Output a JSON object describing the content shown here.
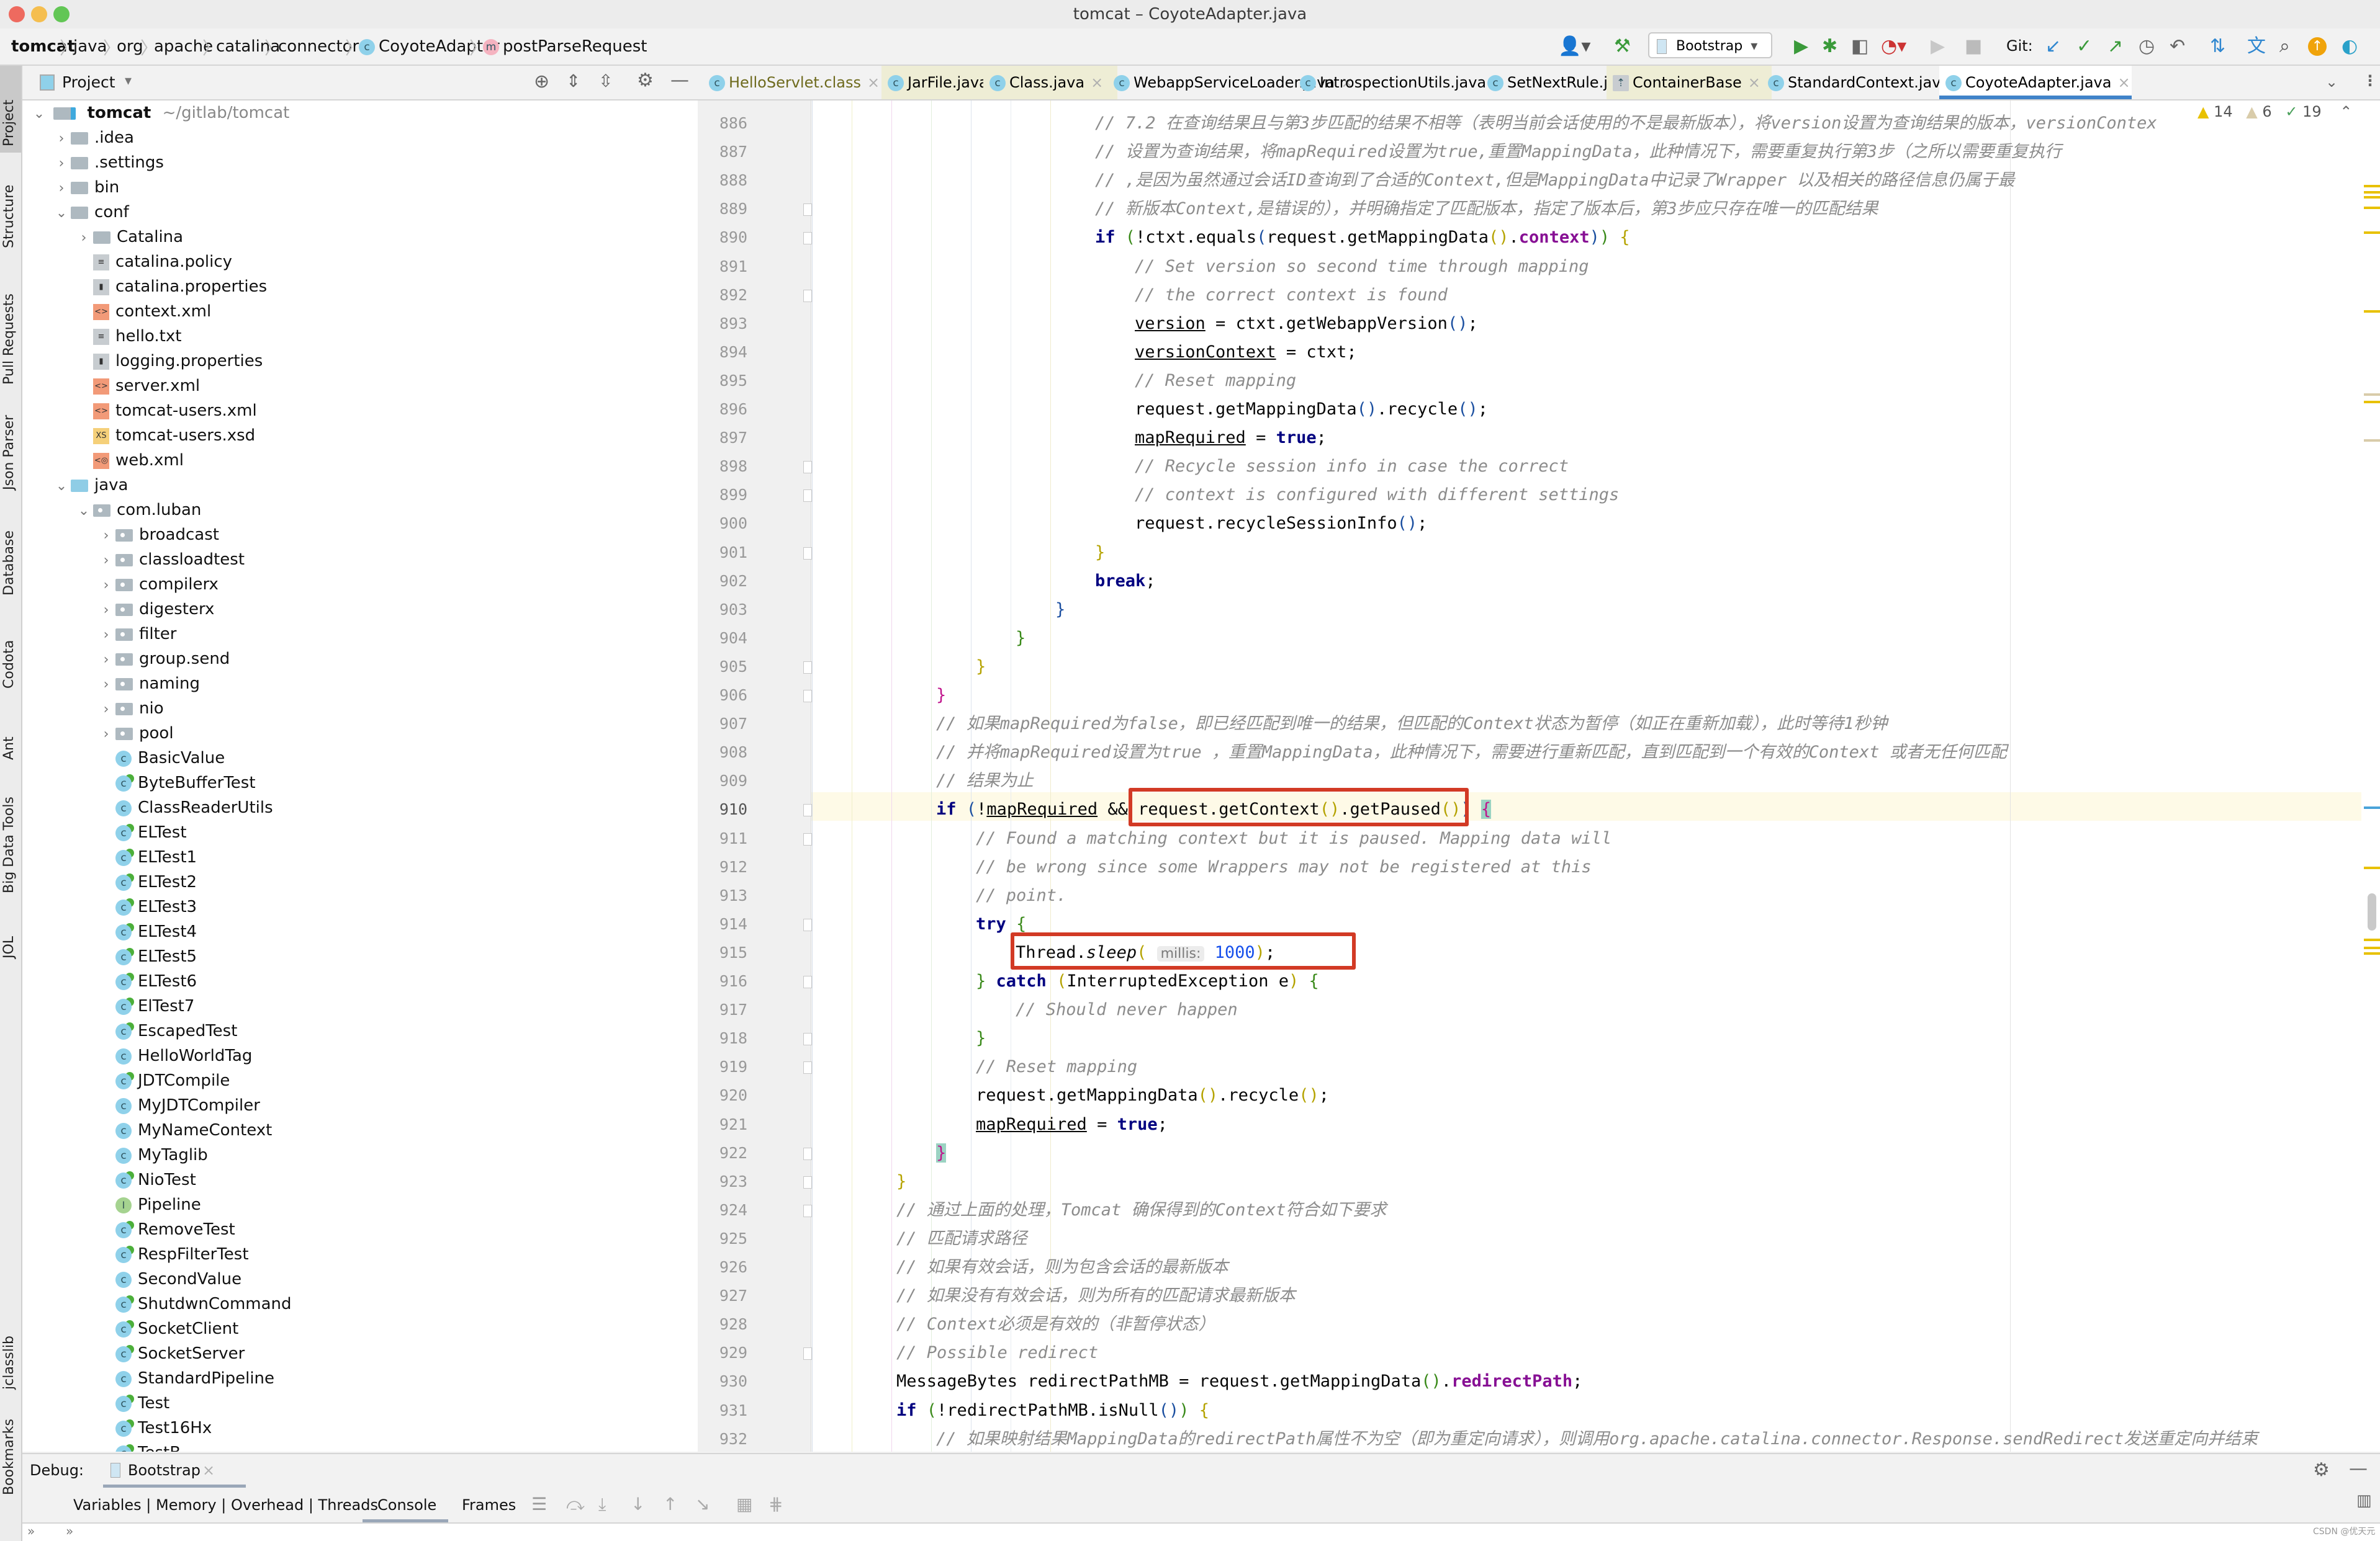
{
  "window": {
    "title": "tomcat – CoyoteAdapter.java",
    "traffic_lights": [
      "#ee6a5f",
      "#f5be4f",
      "#62c655"
    ]
  },
  "breadcrumb": [
    {
      "label": "tomcat",
      "bold": true
    },
    {
      "label": "java"
    },
    {
      "label": "org"
    },
    {
      "label": "apache"
    },
    {
      "label": "catalina"
    },
    {
      "label": "connector"
    },
    {
      "label": "CoyoteAdapter",
      "badge": "c"
    },
    {
      "label": "postParseRequest",
      "badge": "m"
    }
  ],
  "toolbar": {
    "run_config": "Bootstrap",
    "git_label": "Git:"
  },
  "left_strip": [
    "Project",
    "Structure",
    "Pull Requests",
    "Json Parser",
    "Database",
    "Codota",
    "Ant",
    "Big Data Tools",
    "JOL",
    "jclasslib",
    "Bookmarks"
  ],
  "project_panel": {
    "title": "Project",
    "root": {
      "name": "tomcat",
      "path": "~/gitlab/tomcat"
    },
    "items": [
      {
        "label": ".idea",
        "type": "folder",
        "depth": 1,
        "chev": ">"
      },
      {
        "label": ".settings",
        "type": "folder",
        "depth": 1,
        "chev": ">"
      },
      {
        "label": "bin",
        "type": "folder",
        "depth": 1,
        "chev": ">"
      },
      {
        "label": "conf",
        "type": "folder",
        "depth": 1,
        "chev": "v"
      },
      {
        "label": "Catalina",
        "type": "folder",
        "depth": 2,
        "chev": ">"
      },
      {
        "label": "catalina.policy",
        "type": "text",
        "depth": 2
      },
      {
        "label": "catalina.properties",
        "type": "props",
        "depth": 2
      },
      {
        "label": "context.xml",
        "type": "xml",
        "depth": 2
      },
      {
        "label": "hello.txt",
        "type": "text",
        "depth": 2
      },
      {
        "label": "logging.properties",
        "type": "props",
        "depth": 2
      },
      {
        "label": "server.xml",
        "type": "xml",
        "depth": 2
      },
      {
        "label": "tomcat-users.xml",
        "type": "xml",
        "depth": 2
      },
      {
        "label": "tomcat-users.xsd",
        "type": "xsd",
        "depth": 2
      },
      {
        "label": "web.xml",
        "type": "webxml",
        "depth": 2
      },
      {
        "label": "java",
        "type": "src",
        "depth": 1,
        "chev": "v"
      },
      {
        "label": "com.luban",
        "type": "pkg",
        "depth": 2,
        "chev": "v"
      },
      {
        "label": "broadcast",
        "type": "pkg",
        "depth": 3,
        "chev": ">"
      },
      {
        "label": "classloadtest",
        "type": "pkg",
        "depth": 3,
        "chev": ">"
      },
      {
        "label": "compilerx",
        "type": "pkg",
        "depth": 3,
        "chev": ">"
      },
      {
        "label": "digesterx",
        "type": "pkg",
        "depth": 3,
        "chev": ">"
      },
      {
        "label": "filter",
        "type": "pkg",
        "depth": 3,
        "chev": ">"
      },
      {
        "label": "group.send",
        "type": "pkg",
        "depth": 3,
        "chev": ">"
      },
      {
        "label": "naming",
        "type": "pkg",
        "depth": 3,
        "chev": ">"
      },
      {
        "label": "nio",
        "type": "pkg",
        "depth": 3,
        "chev": ">"
      },
      {
        "label": "pool",
        "type": "pkg",
        "depth": 3,
        "chev": ">"
      },
      {
        "label": "BasicValue",
        "type": "class",
        "depth": 3
      },
      {
        "label": "ByteBufferTest",
        "type": "class-run",
        "depth": 3
      },
      {
        "label": "ClassReaderUtils",
        "type": "class",
        "depth": 3
      },
      {
        "label": "ELTest",
        "type": "class-run",
        "depth": 3
      },
      {
        "label": "ELTest1",
        "type": "class-run",
        "depth": 3
      },
      {
        "label": "ELTest2",
        "type": "class-run",
        "depth": 3
      },
      {
        "label": "ELTest3",
        "type": "class-run",
        "depth": 3
      },
      {
        "label": "ELTest4",
        "type": "class-run",
        "depth": 3
      },
      {
        "label": "ELTest5",
        "type": "class-run",
        "depth": 3
      },
      {
        "label": "ELTest6",
        "type": "class-run",
        "depth": 3
      },
      {
        "label": "ElTest7",
        "type": "class-run",
        "depth": 3
      },
      {
        "label": "EscapedTest",
        "type": "class-run",
        "depth": 3
      },
      {
        "label": "HelloWorldTag",
        "type": "class",
        "depth": 3
      },
      {
        "label": "JDTCompile",
        "type": "class-run",
        "depth": 3
      },
      {
        "label": "MyJDTCompiler",
        "type": "class",
        "depth": 3
      },
      {
        "label": "MyNameContext",
        "type": "class",
        "depth": 3
      },
      {
        "label": "MyTaglib",
        "type": "class",
        "depth": 3
      },
      {
        "label": "NioTest",
        "type": "class-run",
        "depth": 3
      },
      {
        "label": "Pipeline",
        "type": "interface",
        "depth": 3
      },
      {
        "label": "RemoveTest",
        "type": "class-run",
        "depth": 3
      },
      {
        "label": "RespFilterTest",
        "type": "class-run",
        "depth": 3
      },
      {
        "label": "SecondValue",
        "type": "class",
        "depth": 3
      },
      {
        "label": "ShutdwnCommand",
        "type": "class-run",
        "depth": 3
      },
      {
        "label": "SocketClient",
        "type": "class-run",
        "depth": 3
      },
      {
        "label": "SocketServer",
        "type": "class-run",
        "depth": 3
      },
      {
        "label": "StandardPipeline",
        "type": "class",
        "depth": 3
      },
      {
        "label": "Test",
        "type": "class-run",
        "depth": 3
      },
      {
        "label": "Test16Hx",
        "type": "class-run",
        "depth": 3
      },
      {
        "label": "TestB",
        "type": "class-run",
        "depth": 3
      }
    ]
  },
  "editor_tabs": [
    {
      "label": "HelloServlet.class",
      "color": "#6e6a1d"
    },
    {
      "label": "JarFile.java",
      "highlight": true
    },
    {
      "label": "Class.java",
      "highlight": true
    },
    {
      "label": "WebappServiceLoader.java"
    },
    {
      "label": "IntrospectionUtils.java"
    },
    {
      "label": "SetNextRule.java"
    },
    {
      "label": "ContainerBase",
      "highlight": true
    },
    {
      "label": "StandardContext.java"
    },
    {
      "label": "CoyoteAdapter.java",
      "active": true
    }
  ],
  "inspections": {
    "warnings": "14",
    "weak_warnings": "6",
    "typos": "19"
  },
  "code": {
    "first_line": 886,
    "current_line": 910,
    "lines": [
      {
        "n": 886,
        "i": 5,
        "h": "<span class='cm'>// 7.2 在查询结果且与第3步匹配的结果不相等（表明当前会话使用的不是最新版本），将version设置为查询结果的版本，versionContex</span>"
      },
      {
        "n": 887,
        "i": 5,
        "h": "<span class='cm'>// 设置为查询结果，将mapRequired设置为true,重置MappingData，此种情况下，需要重复执行第3步（之所以需要重复执行</span>"
      },
      {
        "n": 888,
        "i": 5,
        "h": "<span class='cm'>// ,是因为虽然通过会话ID查询到了合适的Context,但是MappingData中记录了Wrapper 以及相关的路径信息仍属于最</span>"
      },
      {
        "n": 889,
        "i": 5,
        "h": "<span class='cm'>// 新版本Context,是错误的），并明确指定了匹配版本，指定了版本后，第3步应只存在唯一的匹配结果</span>"
      },
      {
        "n": 890,
        "i": 5,
        "h": "<span class='kw2'>if</span> <span class='p2'>(</span>!ctxt.equals<span class='p3'>(</span>request.getMappingData<span class='p1'>()</span>.<span class='fld'>context</span><span class='p3'>)</span><span class='p2'>)</span> <span class='p1'>{</span>"
      },
      {
        "n": 891,
        "i": 6,
        "h": "<span class='cm'>// Set version so second time through mapping</span>"
      },
      {
        "n": 892,
        "i": 6,
        "h": "<span class='cm'>// the correct context is found</span>"
      },
      {
        "n": 893,
        "i": 6,
        "h": "<span class='ul'>version</span> = ctxt.getWebappVersion<span class='p3'>()</span>;"
      },
      {
        "n": 894,
        "i": 6,
        "h": "<span class='ul'>versionContext</span> = ctxt;"
      },
      {
        "n": 895,
        "i": 6,
        "h": "<span class='cm'>// Reset mapping</span>"
      },
      {
        "n": 896,
        "i": 6,
        "h": "request.getMappingData<span class='p3'>()</span>.recycle<span class='p3'>()</span>;"
      },
      {
        "n": 897,
        "i": 6,
        "h": "<span class='ul'>mapRequired</span> = <span class='kw2'>true</span>;"
      },
      {
        "n": 898,
        "i": 6,
        "h": "<span class='cm'>// Recycle session info in case the correct</span>"
      },
      {
        "n": 899,
        "i": 6,
        "h": "<span class='cm'>// context is configured with different settings</span>"
      },
      {
        "n": 900,
        "i": 6,
        "h": "request.recycleSessionInfo<span class='p3'>()</span>;"
      },
      {
        "n": 901,
        "i": 5,
        "h": "<span class='p1'>}</span>"
      },
      {
        "n": 902,
        "i": 5,
        "h": "<span class='kw2'>break</span>;"
      },
      {
        "n": 903,
        "i": 4,
        "h": "<span class='p3'>}</span>"
      },
      {
        "n": 904,
        "i": 3,
        "h": "<span class='p2'>}</span>"
      },
      {
        "n": 905,
        "i": 2,
        "h": "<span class='p1'>}</span>"
      },
      {
        "n": 906,
        "i": 1,
        "h": "<span style='color:#c0148c'>}</span>"
      },
      {
        "n": 907,
        "i": 1,
        "h": "<span class='cm'>// 如果mapRequired为false，即已经匹配到唯一的结果，但匹配的Context状态为暂停（如正在重新加载），此时等待1秒钟</span>"
      },
      {
        "n": 908,
        "i": 1,
        "h": "<span class='cm'>// 并将mapRequired设置为true ，重置MappingData，此种情况下，需要进行重新匹配，直到匹配到一个有效的Context 或者无任何匹配</span>"
      },
      {
        "n": 909,
        "i": 1,
        "h": "<span class='cm'>// 结果为止</span>"
      },
      {
        "n": 910,
        "i": 1,
        "h": "<span class='kw2'>if</span> <span class='p3'>(</span>!<span class='ul'>mapRequired</span> &amp;&amp; request.getContext<span class='p1'>()</span>.getPaused<span class='p1'>()</span><span class='p3'>)</span> <span style='color:#c0148c;background:#9bd3c2'>{</span>"
      },
      {
        "n": 911,
        "i": 2,
        "h": "<span class='cm'>// Found a matching context but it is paused. Mapping data will</span>"
      },
      {
        "n": 912,
        "i": 2,
        "h": "<span class='cm'>// be wrong since some Wrappers may not be registered at this</span>"
      },
      {
        "n": 913,
        "i": 2,
        "h": "<span class='cm'>// point.</span>"
      },
      {
        "n": 914,
        "i": 2,
        "h": "<span class='kw2'>try</span> <span class='p2'>{</span>"
      },
      {
        "n": 915,
        "i": 3,
        "h": "Thread.<span class='it'>sleep</span><span class='p1'>(</span> <span class='hint'>millis:</span> <span class='num'>1000</span><span class='p1'>)</span>;"
      },
      {
        "n": 916,
        "i": 2,
        "h": "<span class='p2'>}</span> <span class='kw2'>catch</span> <span class='p1'>(</span>InterruptedException e<span class='p1'>)</span> <span class='p2'>{</span>"
      },
      {
        "n": 917,
        "i": 3,
        "h": "<span class='cm'>// Should never happen</span>"
      },
      {
        "n": 918,
        "i": 2,
        "h": "<span class='p2'>}</span>"
      },
      {
        "n": 919,
        "i": 2,
        "h": "<span class='cm'>// Reset mapping</span>"
      },
      {
        "n": 920,
        "i": 2,
        "h": "request.getMappingData<span class='p1'>()</span>.recycle<span class='p1'>()</span>;"
      },
      {
        "n": 921,
        "i": 2,
        "h": "<span class='ul'>mapRequired</span> = <span class='kw2'>true</span>;"
      },
      {
        "n": 922,
        "i": 1,
        "h": "<span style='color:#c0148c;background:#9bd3c2'>}</span>"
      },
      {
        "n": 923,
        "i": 0,
        "h": "<span class='p1'>}</span>"
      },
      {
        "n": 924,
        "i": 0,
        "h": "<span class='cm'>// 通过上面的处理，Tomcat 确保得到的Context符合如下要求</span>"
      },
      {
        "n": 925,
        "i": 0,
        "h": "<span class='cm'>// 匹配请求路径</span>"
      },
      {
        "n": 926,
        "i": 0,
        "h": "<span class='cm'>// 如果有效会话，则为包含会话的最新版本</span>"
      },
      {
        "n": 927,
        "i": 0,
        "h": "<span class='cm'>// 如果没有有效会话，则为所有的匹配请求最新版本</span>"
      },
      {
        "n": 928,
        "i": 0,
        "h": "<span class='cm'>// Context必须是有效的（非暂停状态）</span>"
      },
      {
        "n": 929,
        "i": 0,
        "h": "<span class='cm'>// Possible redirect</span>"
      },
      {
        "n": 930,
        "i": 0,
        "h": "MessageBytes redirectPathMB = request.getMappingData<span class='p2'>()</span>.<span class='fld'>redirectPath</span>;"
      },
      {
        "n": 931,
        "i": 0,
        "h": "<span class='kw2'>if</span> <span class='p2'>(</span>!redirectPathMB.isNull<span class='p3'>()</span><span class='p2'>)</span> <span class='p1'>{</span>"
      },
      {
        "n": 932,
        "i": 1,
        "h": "<span class='cm'>// 如果映射结果MappingData的redirectPath属性不为空（即为重定向请求），则调用org.apache.catalina.connector.Response.sendRedirect发送重定向并结束</span>"
      }
    ]
  },
  "debug": {
    "label": "Debug:",
    "session": "Bootstrap",
    "tabs": [
      "Variables | Memory | Overhead | Threads",
      "Console",
      "Frames"
    ],
    "active_tab": "Console"
  },
  "watermark": "CSDN @优天元"
}
